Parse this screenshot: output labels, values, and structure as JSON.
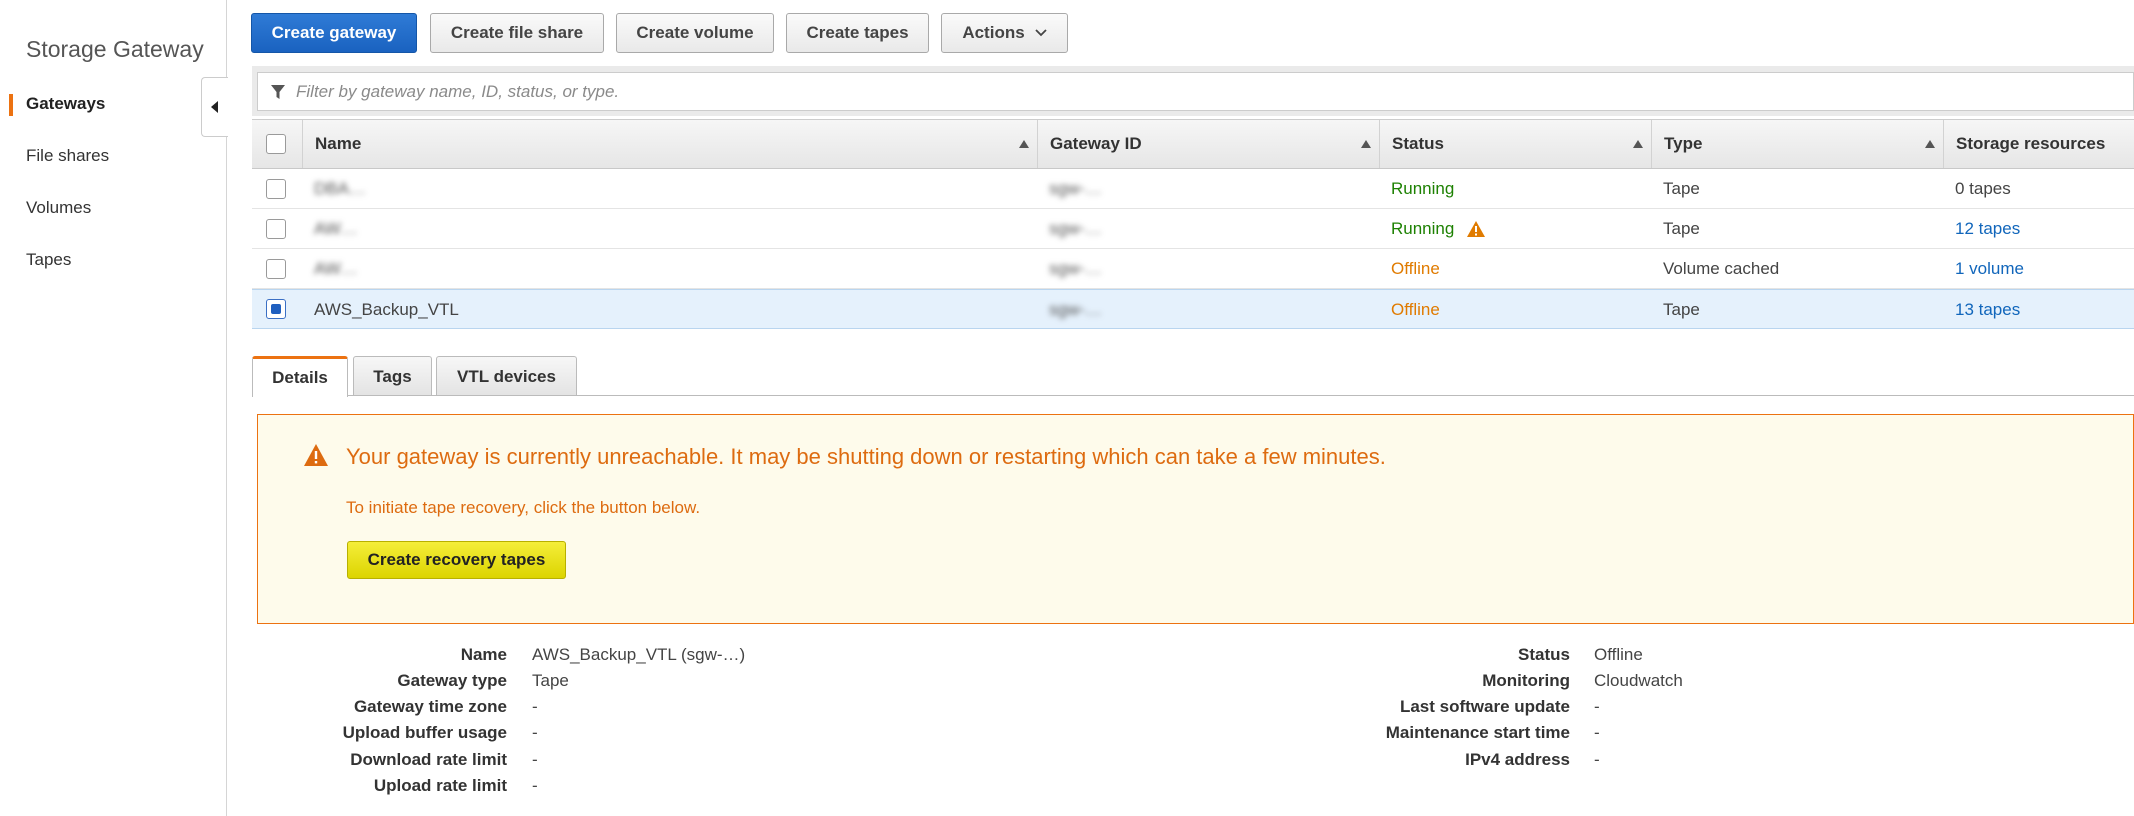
{
  "sidebar": {
    "title": "Storage Gateway",
    "items": [
      {
        "label": "Gateways",
        "active": true
      },
      {
        "label": "File shares",
        "active": false
      },
      {
        "label": "Volumes",
        "active": false
      },
      {
        "label": "Tapes",
        "active": false
      }
    ]
  },
  "toolbar": {
    "create_gateway": "Create gateway",
    "create_file_share": "Create file share",
    "create_volume": "Create volume",
    "create_tapes": "Create tapes",
    "actions": "Actions"
  },
  "filter": {
    "placeholder": "Filter by gateway name, ID, status, or type."
  },
  "table": {
    "columns": [
      "Name",
      "Gateway ID",
      "Status",
      "Type",
      "Storage resources"
    ],
    "rows": [
      {
        "name": "DBA…",
        "gateway_id": "sgw-…",
        "status": "Running",
        "type": "Tape",
        "storage": "0 tapes",
        "selected": false
      },
      {
        "name": "AW…",
        "gateway_id": "sgw-…",
        "status": "Running",
        "type": "Tape",
        "storage": "12 tapes",
        "selected": false
      },
      {
        "name": "AW…",
        "gateway_id": "sgw-…",
        "status": "Offline",
        "type": "Volume cached",
        "storage": "1 volume",
        "selected": false
      },
      {
        "name": "AWS_Backup_VTL",
        "gateway_id": "sgw-…",
        "status": "Offline",
        "type": "Tape",
        "storage": "13 tapes",
        "selected": true
      }
    ]
  },
  "tabs": [
    "Details",
    "Tags",
    "VTL devices"
  ],
  "alert": {
    "message": "Your gateway is currently unreachable. It may be shutting down or restarting which can take a few minutes.",
    "sub": "To initiate tape recovery, click the button below.",
    "button": "Create recovery tapes"
  },
  "details": {
    "left": [
      {
        "label": "Name",
        "value": "AWS_Backup_VTL (sgw-…)"
      },
      {
        "label": "Gateway type",
        "value": "Tape"
      },
      {
        "label": "Gateway time zone",
        "value": "-"
      },
      {
        "label": "Upload buffer usage",
        "value": "-"
      },
      {
        "label": "Download rate limit",
        "value": "-"
      },
      {
        "label": "Upload rate limit",
        "value": "-"
      }
    ],
    "right": [
      {
        "label": "Status",
        "value": "Offline"
      },
      {
        "label": "Monitoring",
        "value": "Cloudwatch"
      },
      {
        "label": "Last software update",
        "value": "-"
      },
      {
        "label": "Maintenance start time",
        "value": "-"
      },
      {
        "label": "IPv4 address",
        "value": "-"
      }
    ]
  },
  "colors": {
    "primary": "#1a62c0",
    "accent": "#ec7211",
    "running": "#1d8102",
    "offline": "#e07b00",
    "link": "#1166bb",
    "alert_bg": "#fefbeb",
    "recovery_button": "#e8e01a"
  },
  "icons": [
    "chevron-left-icon",
    "chevron-down-icon",
    "filter-icon",
    "sort-up-icon",
    "warning-icon",
    "checkbox"
  ]
}
